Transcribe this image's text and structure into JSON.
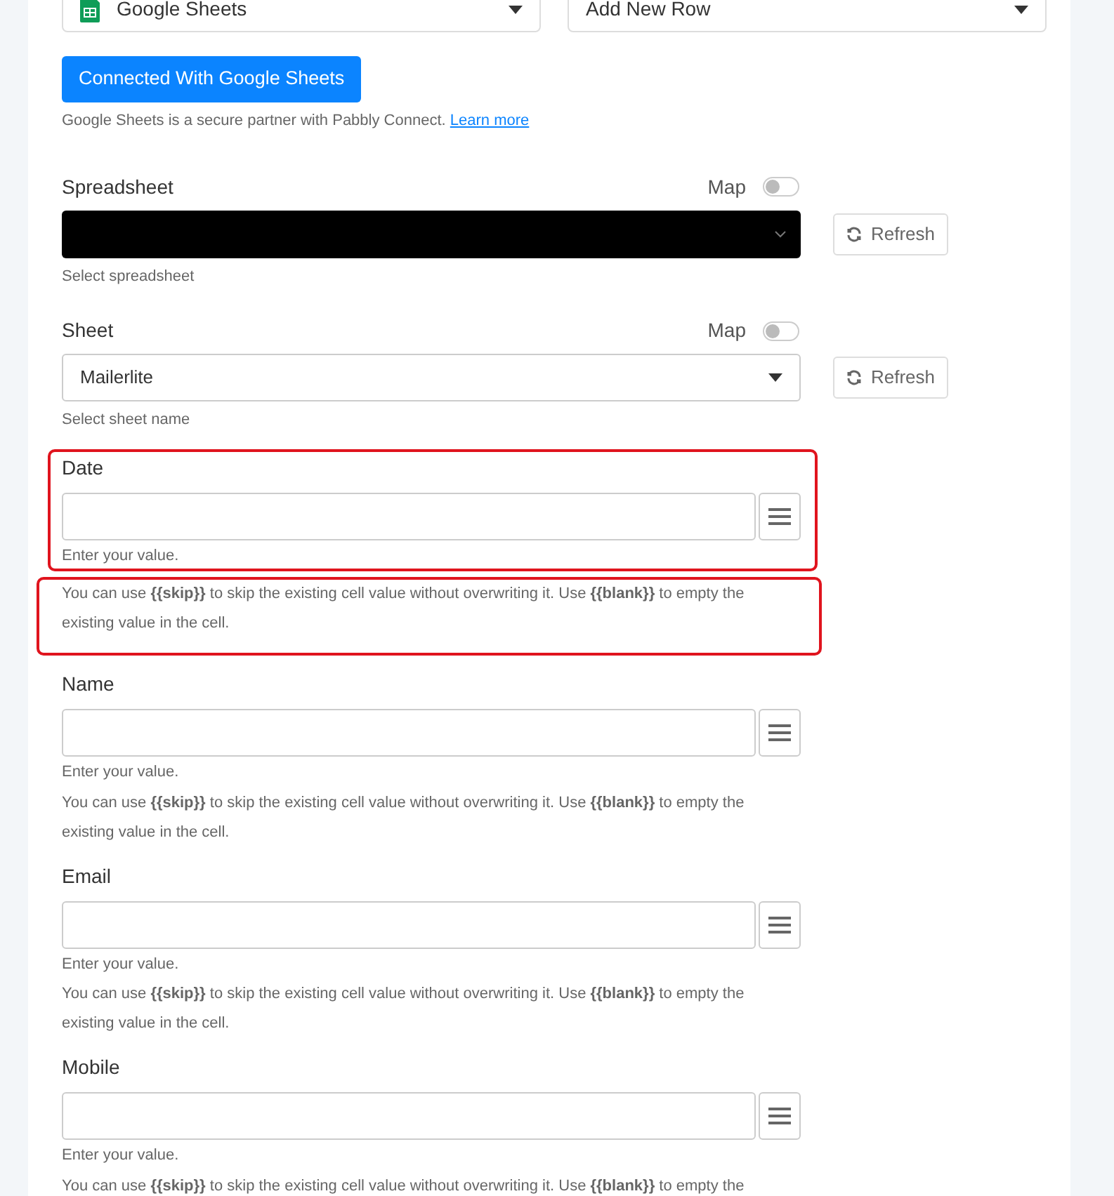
{
  "top_selects": [
    {
      "value": "Google Sheets",
      "kind": "app"
    },
    {
      "value": "Add New Row",
      "kind": "plain"
    }
  ],
  "connect_button": "Connected With Google Sheets",
  "partner_note": {
    "text": "Google Sheets is a secure partner with Pabbly Connect.",
    "link": "Learn more"
  },
  "selects": [
    {
      "label": "Spreadsheet",
      "map_label": "Map",
      "map_on": false,
      "redacted": true,
      "hint": "Select spreadsheet",
      "refresh": "Refresh"
    },
    {
      "label": "Sheet",
      "map_label": "Map",
      "map_on": false,
      "redacted": false,
      "value": "Mailerlite",
      "hint": "Select sheet name",
      "refresh": "Refresh"
    }
  ],
  "fields": [
    {
      "label": "Date",
      "highlighted": true,
      "hint": "Enter your value.",
      "note": "You can use **{{skip}}** to skip the existing cell value without overwriting it. Use **{{blank}}** to empty the existing value in the cell."
    },
    {
      "label": "Name",
      "highlighted": false,
      "hint": "Enter your value.",
      "note": "You can use **{{skip}}** to skip the existing cell value without overwriting it. Use **{{blank}}** to empty the existing value in the cell."
    },
    {
      "label": "Email",
      "highlighted": false,
      "hint": "Enter your value.",
      "note": "You can use **{{skip}}** to skip the existing cell value without overwriting it. Use **{{blank}}** to empty the existing value in the cell."
    },
    {
      "label": "Mobile",
      "highlighted": false,
      "hint": "Enter your value.",
      "note": "You can use **{{skip}}** to skip the existing cell value without overwriting it. Use **{{blank}}** to empty the"
    }
  ]
}
